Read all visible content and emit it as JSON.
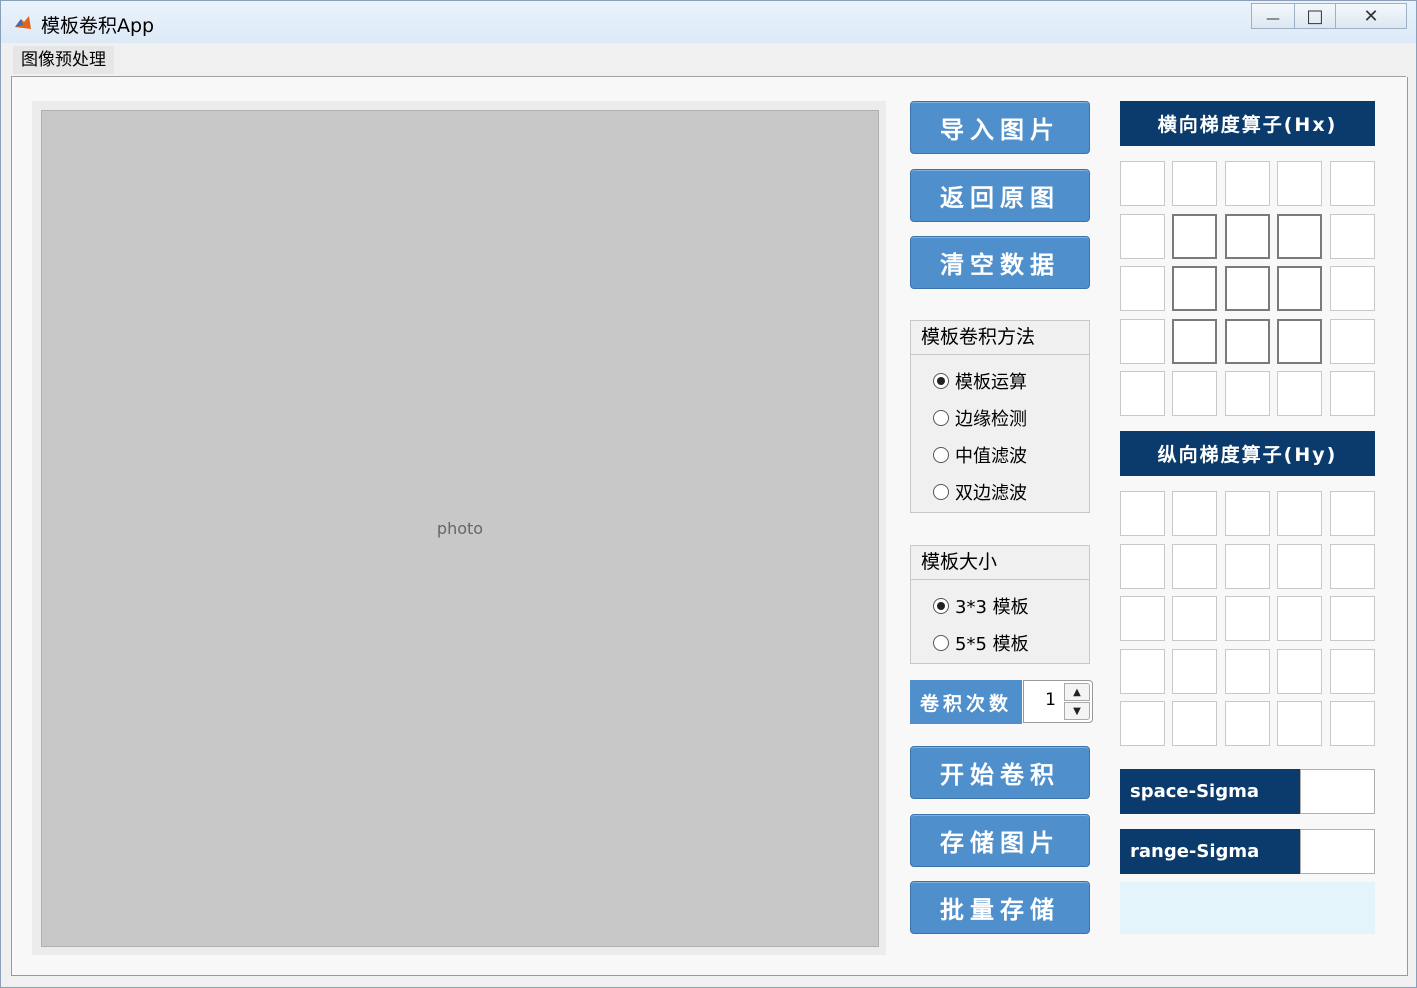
{
  "window": {
    "title": "模板卷积App",
    "minimize_glyph": "—",
    "maximize_glyph": "□",
    "close_glyph": "✕"
  },
  "menu": {
    "items": [
      "图像预处理"
    ]
  },
  "buttons": {
    "import_image": "导入图片",
    "restore_original": "返回原图",
    "clear_data": "清空数据",
    "start_convolution": "开始卷积",
    "save_image": "存储图片",
    "batch_save": "批量存储"
  },
  "method_group": {
    "title": "模板卷积方法",
    "options": [
      "模板运算",
      "边缘检测",
      "中值滤波",
      "双边滤波"
    ],
    "selected": "模板运算"
  },
  "size_group": {
    "title": "模板大小",
    "options": [
      "3*3 模板",
      "5*5 模板"
    ],
    "selected": "3*3 模板"
  },
  "iterations": {
    "label": "卷积次数",
    "value": "1"
  },
  "hx": {
    "title": "横向梯度算子(Hx)"
  },
  "hy": {
    "title": "纵向梯度算子(Hy)"
  },
  "sigma": {
    "space_label": "space-Sigma",
    "range_label": "range-Sigma"
  },
  "colors": {
    "button_blue": "#4f8fcb",
    "header_navy": "#0b3b6c"
  }
}
